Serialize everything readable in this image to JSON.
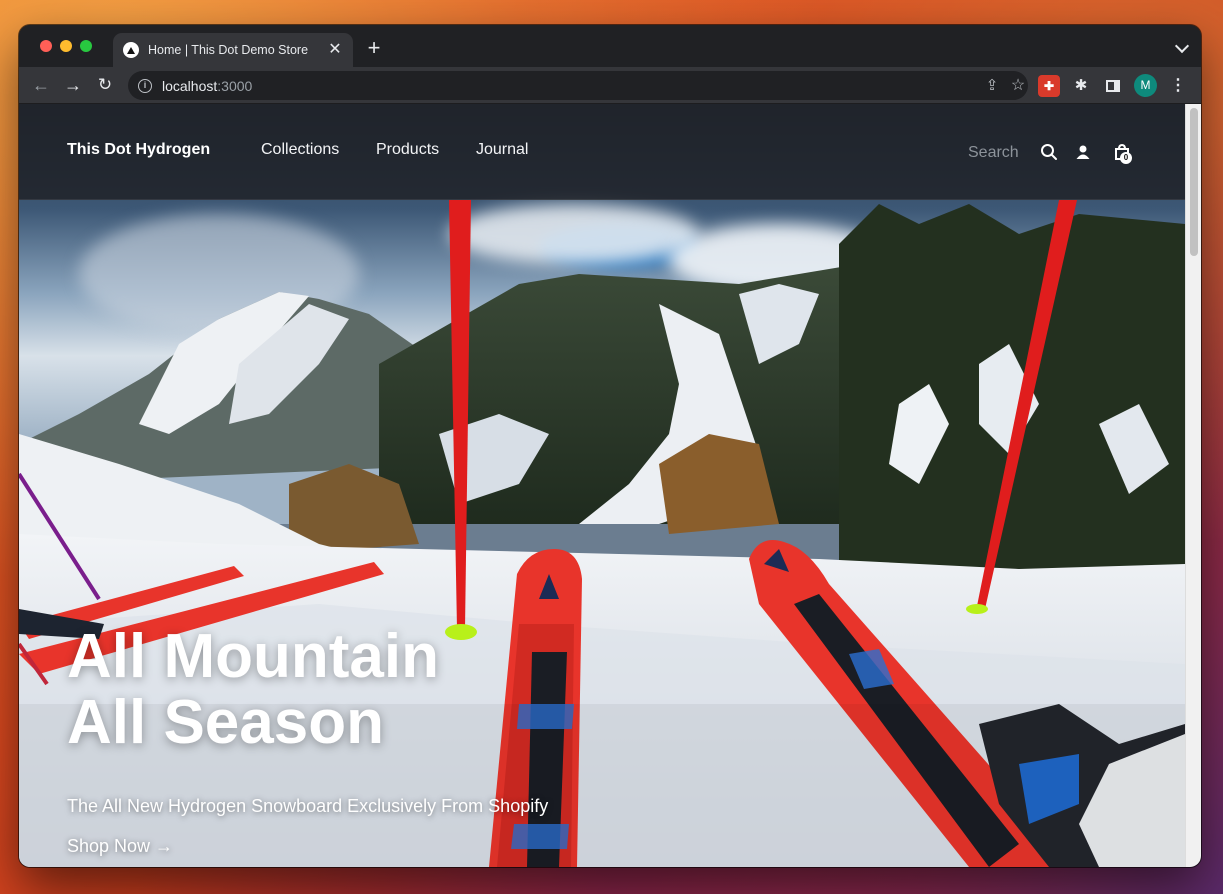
{
  "browser": {
    "tab_title": "Home | This Dot Demo Store",
    "tab_close_icon": "close-icon",
    "new_tab_icon": "plus-icon",
    "url_host": "localhost",
    "url_port": ":3000",
    "extension_badge": "✚",
    "profile_initial": "M"
  },
  "site": {
    "brand": "This Dot Hydrogen",
    "nav": [
      "Collections",
      "Products",
      "Journal"
    ],
    "search_placeholder": "Search",
    "cart_count": "0"
  },
  "hero": {
    "title_line1": "All Mountain",
    "title_line2": "All Season",
    "subtitle": "The All New Hydrogen Snowboard Exclusively From Shopify",
    "cta": "Shop Now →"
  },
  "colors": {
    "ski_red": "#e8342b",
    "pole_red": "#e01d1d",
    "profile_avatar": "#0e8a7c"
  }
}
